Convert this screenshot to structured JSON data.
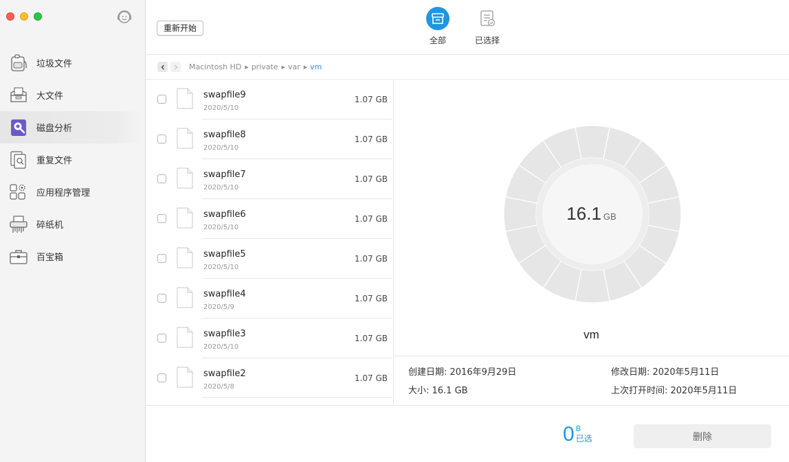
{
  "sidebar": {
    "items": [
      {
        "label": "垃圾文件",
        "icon": "vacuum-icon",
        "active": false
      },
      {
        "label": "大文件",
        "icon": "large-file-box-icon",
        "active": false
      },
      {
        "label": "磁盘分析",
        "icon": "disk-analysis-icon",
        "active": true
      },
      {
        "label": "重复文件",
        "icon": "duplicate-file-icon",
        "active": false
      },
      {
        "label": "应用程序管理",
        "icon": "app-manager-icon",
        "active": false
      },
      {
        "label": "碎纸机",
        "icon": "shredder-icon",
        "active": false
      },
      {
        "label": "百宝箱",
        "icon": "toolbox-icon",
        "active": false
      }
    ]
  },
  "toolbar": {
    "restart_label": "重新开始",
    "tabs": [
      {
        "label": "全部",
        "icon": "archive-box-icon",
        "active": true
      },
      {
        "label": "已选择",
        "icon": "selected-list-icon",
        "active": false
      }
    ]
  },
  "breadcrumb": [
    "Macintosh HD",
    "private",
    "var",
    "vm"
  ],
  "files": [
    {
      "name": "swapfile9",
      "date": "2020/5/10",
      "size": "1.07 GB"
    },
    {
      "name": "swapfile8",
      "date": "2020/5/10",
      "size": "1.07 GB"
    },
    {
      "name": "swapfile7",
      "date": "2020/5/10",
      "size": "1.07 GB"
    },
    {
      "name": "swapfile6",
      "date": "2020/5/10",
      "size": "1.07 GB"
    },
    {
      "name": "swapfile5",
      "date": "2020/5/10",
      "size": "1.07 GB"
    },
    {
      "name": "swapfile4",
      "date": "2020/5/9",
      "size": "1.07 GB"
    },
    {
      "name": "swapfile3",
      "date": "2020/5/10",
      "size": "1.07 GB"
    },
    {
      "name": "swapfile2",
      "date": "2020/5/8",
      "size": "1.07 GB"
    }
  ],
  "chart": {
    "total_value": "16.1",
    "total_unit": "GB",
    "folder_name": "vm",
    "segment_count": 16,
    "segment_color": "#e6e6e6",
    "inner_ring_color": "#ededed",
    "center_color": "#f6f6f6"
  },
  "info": {
    "created": "创建日期:   2016年9月29日",
    "size": "大小: 16.1 GB",
    "modified": "修改日期: 2020年5月11日",
    "last_opened": "上次打开时间: 2020年5月11日"
  },
  "footer": {
    "selected_value": "0",
    "selected_unit": "B",
    "selected_label": "已选",
    "delete_label": "删除",
    "accent_color": "#2196e0"
  }
}
